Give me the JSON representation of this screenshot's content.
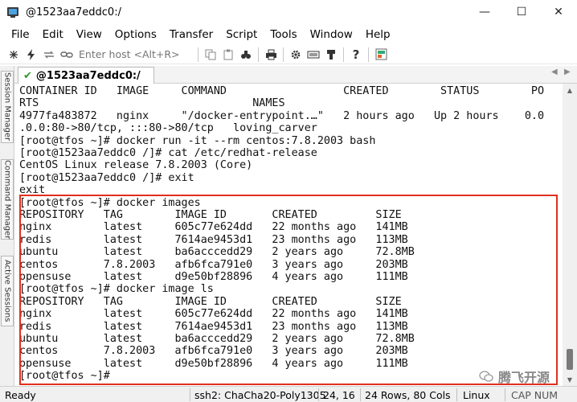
{
  "window": {
    "title": "@1523aa7eddc0:/",
    "minimize": "—",
    "maximize": "☐",
    "close": "✕"
  },
  "menu": [
    "File",
    "Edit",
    "View",
    "Options",
    "Transfer",
    "Script",
    "Tools",
    "Window",
    "Help"
  ],
  "toolbar": {
    "host_placeholder": "Enter host <Alt+R>"
  },
  "sidebar": {
    "tabs": [
      "Session Manager",
      "Command Manager",
      "Active Sessions"
    ]
  },
  "tab": {
    "label": "@1523aa7eddc0:/",
    "prev": "◀",
    "next": "▶"
  },
  "terminal": {
    "lines": [
      "CONTAINER ID   IMAGE     COMMAND                  CREATED        STATUS        PO",
      "RTS                                 NAMES",
      "4977fa483872   nginx     \"/docker-entrypoint.…\"   2 hours ago   Up 2 hours    0.0",
      ".0.0:80->80/tcp, :::80->80/tcp   loving_carver",
      "[root@tfos ~]# docker run -it --rm centos:7.8.2003 bash",
      "[root@1523aa7eddc0 /]# cat /etc/redhat-release",
      "CentOS Linux release 7.8.2003 (Core)",
      "[root@1523aa7eddc0 /]# exit",
      "exit",
      "[root@tfos ~]# docker images",
      "REPOSITORY   TAG        IMAGE ID       CREATED         SIZE",
      "nginx        latest     605c77e624dd   22 months ago   141MB",
      "redis        latest     7614ae9453d1   23 months ago   113MB",
      "ubuntu       latest     ba6acccedd29   2 years ago     72.8MB",
      "centos       7.8.2003   afb6fca791e0   3 years ago     203MB",
      "opensuse     latest     d9e50bf28896   4 years ago     111MB",
      "[root@tfos ~]# docker image ls",
      "REPOSITORY   TAG        IMAGE ID       CREATED         SIZE",
      "nginx        latest     605c77e624dd   22 months ago   141MB",
      "redis        latest     7614ae9453d1   23 months ago   113MB",
      "ubuntu       latest     ba6acccedd29   2 years ago     72.8MB",
      "centos       7.8.2003   afb6fca791e0   3 years ago     203MB",
      "opensuse     latest     d9e50bf28896   4 years ago     111MB",
      "[root@tfos ~]# "
    ],
    "highlight_color": "#e0301e"
  },
  "watermark": "腾飞开源",
  "status": {
    "ready": "Ready",
    "cipher": "ssh2: ChaCha20-Poly1305",
    "position": "24, 16",
    "size": "24 Rows, 80 Cols",
    "os": "Linux",
    "keys": "CAP NUM"
  }
}
